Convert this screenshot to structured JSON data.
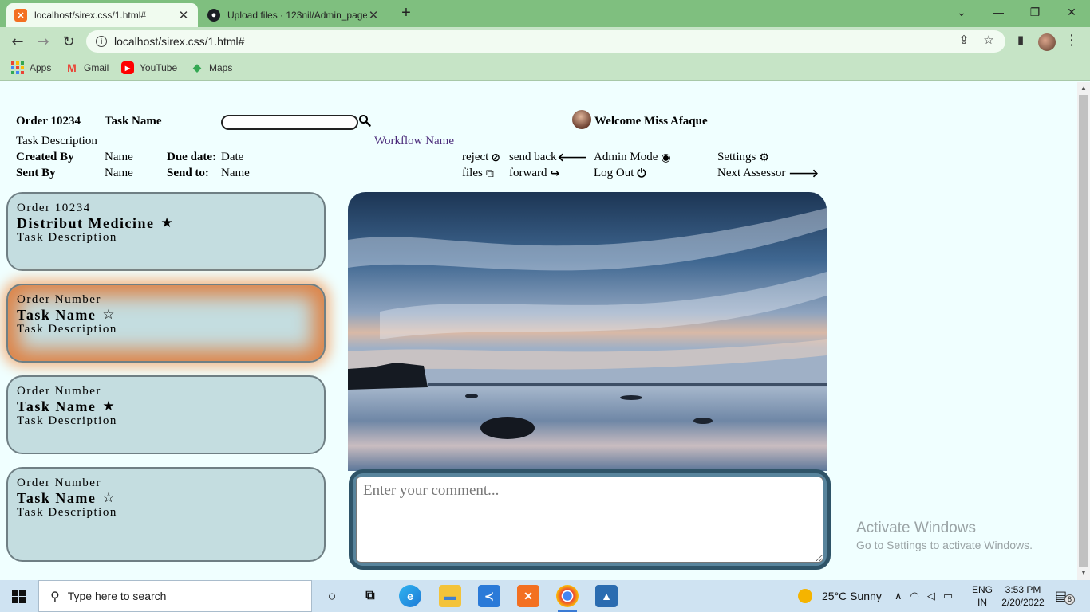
{
  "browser": {
    "tabs": [
      {
        "title": "localhost/sirex.css/1.html#",
        "icon": "xampp-icon",
        "active": true
      },
      {
        "title": "Upload files · 123nil/Admin_page",
        "icon": "github-icon",
        "active": false
      }
    ],
    "url": "localhost/sirex.css/1.html#",
    "bookmarks": [
      {
        "label": "Apps",
        "icon": "apps-grid-icon"
      },
      {
        "label": "Gmail",
        "icon": "gmail-icon"
      },
      {
        "label": "YouTube",
        "icon": "youtube-icon"
      },
      {
        "label": "Maps",
        "icon": "maps-icon"
      }
    ]
  },
  "header": {
    "order": "Order 10234",
    "task_name": "Task Name",
    "welcome": "Welcome Miss Afaque",
    "task_description": "Task Description",
    "workflow_name": "Workflow Name",
    "created_by_label": "Created By",
    "created_by_value": "Name",
    "due_date_label": "Due date:",
    "due_date_value": "Date",
    "sent_by_label": "Sent By",
    "sent_by_value": "Name",
    "send_to_label": "Send to:",
    "send_to_value": "Name"
  },
  "actions": {
    "reject": "reject",
    "send_back": "send back",
    "admin_mode": "Admin Mode",
    "settings": "Settings",
    "files": "files",
    "forward": "forward",
    "log_out": "Log Out",
    "next_assessor": "Next Assessor"
  },
  "tasks": [
    {
      "order": "Order 10234",
      "name": "Distribut Medicine",
      "description": "Task Description",
      "starred": true,
      "highlighted": false
    },
    {
      "order": "Order Number",
      "name": "Task Name",
      "description": "Task Description",
      "starred": false,
      "highlighted": true
    },
    {
      "order": "Order Number",
      "name": "Task Name",
      "description": "Task Description",
      "starred": true,
      "highlighted": false
    },
    {
      "order": "Order Number",
      "name": "Task Name",
      "description": "Task Description",
      "starred": false,
      "highlighted": false
    }
  ],
  "comment": {
    "placeholder": "Enter your comment..."
  },
  "watermark": {
    "line1": "Activate Windows",
    "line2": "Go to Settings to activate Windows."
  },
  "taskbar": {
    "search_placeholder": "Type here to search",
    "weather": "25°C  Sunny",
    "lang_top": "ENG",
    "lang_bottom": "IN",
    "time": "3:53 PM",
    "date": "2/20/2022",
    "notifications": "8"
  },
  "colors": {
    "page_bg": "#f0ffff",
    "card_bg": "#c4dde0",
    "highlight_glow": "#dd8448",
    "chrome_green": "#7fbf7f",
    "comment_frame": "#2f5468"
  }
}
